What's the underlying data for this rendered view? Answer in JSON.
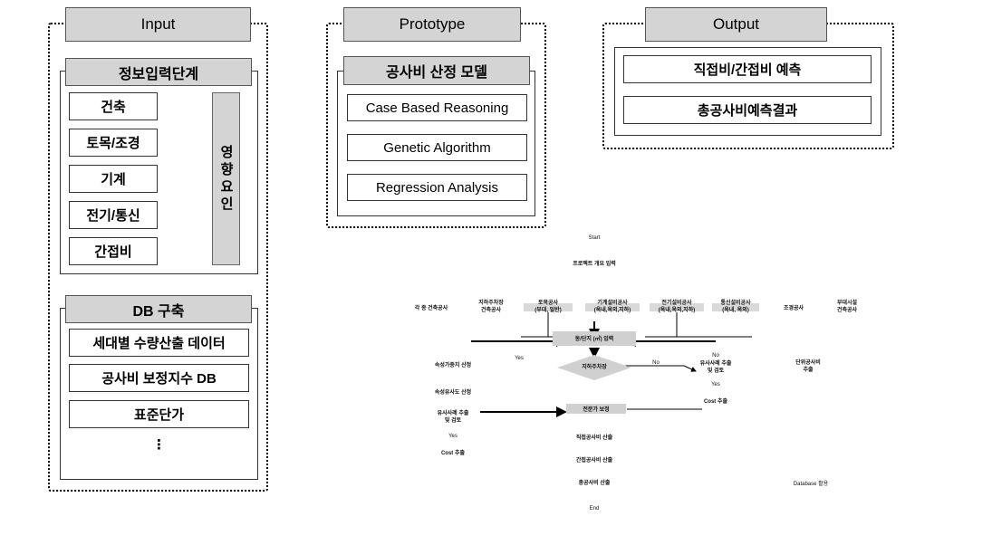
{
  "groups": {
    "input": {
      "title": "Input",
      "sections": [
        {
          "title": "정보입력단계",
          "items": [
            "건축",
            "토목/조경",
            "기계",
            "전기/통신",
            "간접비"
          ],
          "side_label": "영향요인"
        },
        {
          "title": "DB 구축",
          "items": [
            "세대별 수량산출 데이터",
            "공사비 보정지수 DB",
            "표준단가"
          ],
          "ellipsis": "⋮"
        }
      ]
    },
    "prototype": {
      "title": "Prototype",
      "sections": [
        {
          "title": "공사비 산정 모델",
          "items": [
            "Case Based Reasoning",
            "Genetic Algorithm",
            "Regression Analysis"
          ]
        }
      ]
    },
    "output": {
      "title": "Output",
      "sections": [
        {
          "title": "",
          "items": [
            "직접비/간접비 예측",
            "총공사비예측결과"
          ]
        }
      ]
    }
  },
  "flowchart": {
    "type": "flowchart",
    "start": "Start",
    "end": "End",
    "steps": [
      "프로젝트 개요 입력",
      "동/단지 (㎡) 입력",
      "전문가 보정",
      "직접공사비 산출",
      "간접공사비 산출",
      "총공사비 산출"
    ],
    "columns": [
      "각 종 건축공사",
      "지하주차장\n건축공사",
      "토목공사\n(부대, 일반)",
      "기계설비공사\n(옥내,옥외,지하)",
      "전기설비공사\n(옥내,옥외,지하)",
      "통신설비공사\n(옥내, 옥외)",
      "조경공사",
      "부대시설\n건축공사"
    ],
    "decision": "지하주차장",
    "left_branch": [
      "속성가중치 산정",
      "속성유사도 산정",
      "유사사례 추출\n및 검토",
      "Yes",
      "Cost 추출"
    ],
    "right_branch": [
      "유사사례 추출\n및 검토",
      "Yes",
      "Cost 추출"
    ],
    "unit_cost": "단위공사비\n추출",
    "database": "Database 활용",
    "yes_label": "Yes",
    "no_label": "No"
  },
  "colors": {
    "chip_fill": "#d4d4d4",
    "border": "#333333",
    "dotted": "#000000"
  }
}
